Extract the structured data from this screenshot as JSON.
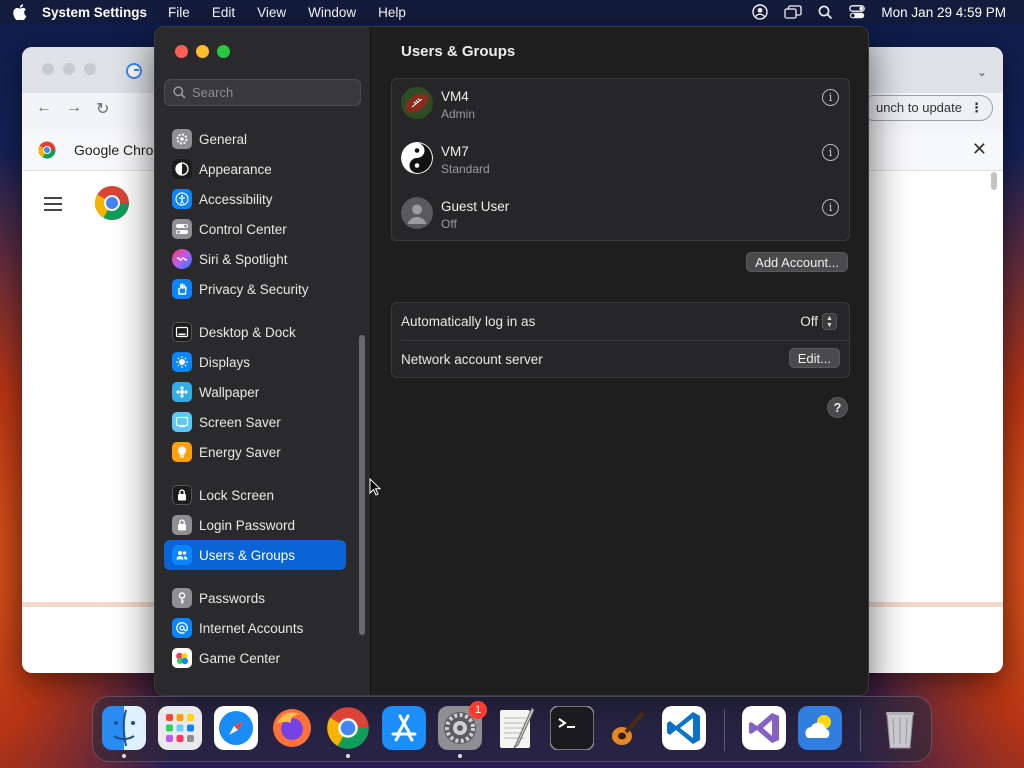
{
  "menubar": {
    "app_name": "System Settings",
    "menus": [
      "File",
      "Edit",
      "View",
      "Window",
      "Help"
    ],
    "clock": "Mon Jan 29  4:59 PM"
  },
  "chrome": {
    "tab_title": "Google Chrome",
    "relaunch_label": "unch to update"
  },
  "settings": {
    "search_placeholder": "Search",
    "sidebar": {
      "items": [
        {
          "label": "General",
          "icon": "gear-icon",
          "color": "#8e8e93"
        },
        {
          "label": "Appearance",
          "icon": "appearance-icon",
          "color": "#1c1c1e"
        },
        {
          "label": "Accessibility",
          "icon": "accessibility-icon",
          "color": "#0a84ff"
        },
        {
          "label": "Control Center",
          "icon": "control-center-icon",
          "color": "#8e8e93"
        },
        {
          "label": "Siri & Spotlight",
          "icon": "siri-icon",
          "color": "#bf5af2"
        },
        {
          "label": "Privacy & Security",
          "icon": "hand-icon",
          "color": "#0a84ff"
        },
        {
          "label": "Desktop & Dock",
          "icon": "dock-icon",
          "color": "#1c1c1e"
        },
        {
          "label": "Displays",
          "icon": "displays-icon",
          "color": "#0a84ff"
        },
        {
          "label": "Wallpaper",
          "icon": "wallpaper-icon",
          "color": "#32ade6"
        },
        {
          "label": "Screen Saver",
          "icon": "screen-saver-icon",
          "color": "#5ac8fa"
        },
        {
          "label": "Energy Saver",
          "icon": "bulb-icon",
          "color": "#ff9f0a"
        },
        {
          "label": "Lock Screen",
          "icon": "lock-icon",
          "color": "#1c1c1e"
        },
        {
          "label": "Login Password",
          "icon": "lock-icon",
          "color": "#8e8e93"
        },
        {
          "label": "Users & Groups",
          "icon": "users-icon",
          "color": "#0a84ff"
        },
        {
          "label": "Passwords",
          "icon": "key-icon",
          "color": "#8e8e93"
        },
        {
          "label": "Internet Accounts",
          "icon": "at-icon",
          "color": "#0a84ff"
        },
        {
          "label": "Game Center",
          "icon": "game-center-icon",
          "color": "#ff375f"
        }
      ],
      "active": "Users & Groups"
    },
    "page_title": "Users & Groups",
    "users": [
      {
        "name": "VM4",
        "role": "Admin"
      },
      {
        "name": "VM7",
        "role": "Standard"
      },
      {
        "name": "Guest User",
        "role": "Off"
      }
    ],
    "add_account_label": "Add Account...",
    "auto_login": {
      "label": "Automatically log in as",
      "value": "Off"
    },
    "network_server": {
      "label": "Network account server",
      "button": "Edit..."
    },
    "help_label": "?"
  },
  "dock": {
    "items": [
      "Finder",
      "Launchpad",
      "Safari",
      "Firefox",
      "Google Chrome",
      "App Store",
      "System Settings",
      "TextEdit",
      "Terminal",
      "GarageBand",
      "Visual Studio Code",
      "Visual Studio",
      "Weather",
      "Trash"
    ],
    "settings_badge": "1"
  }
}
